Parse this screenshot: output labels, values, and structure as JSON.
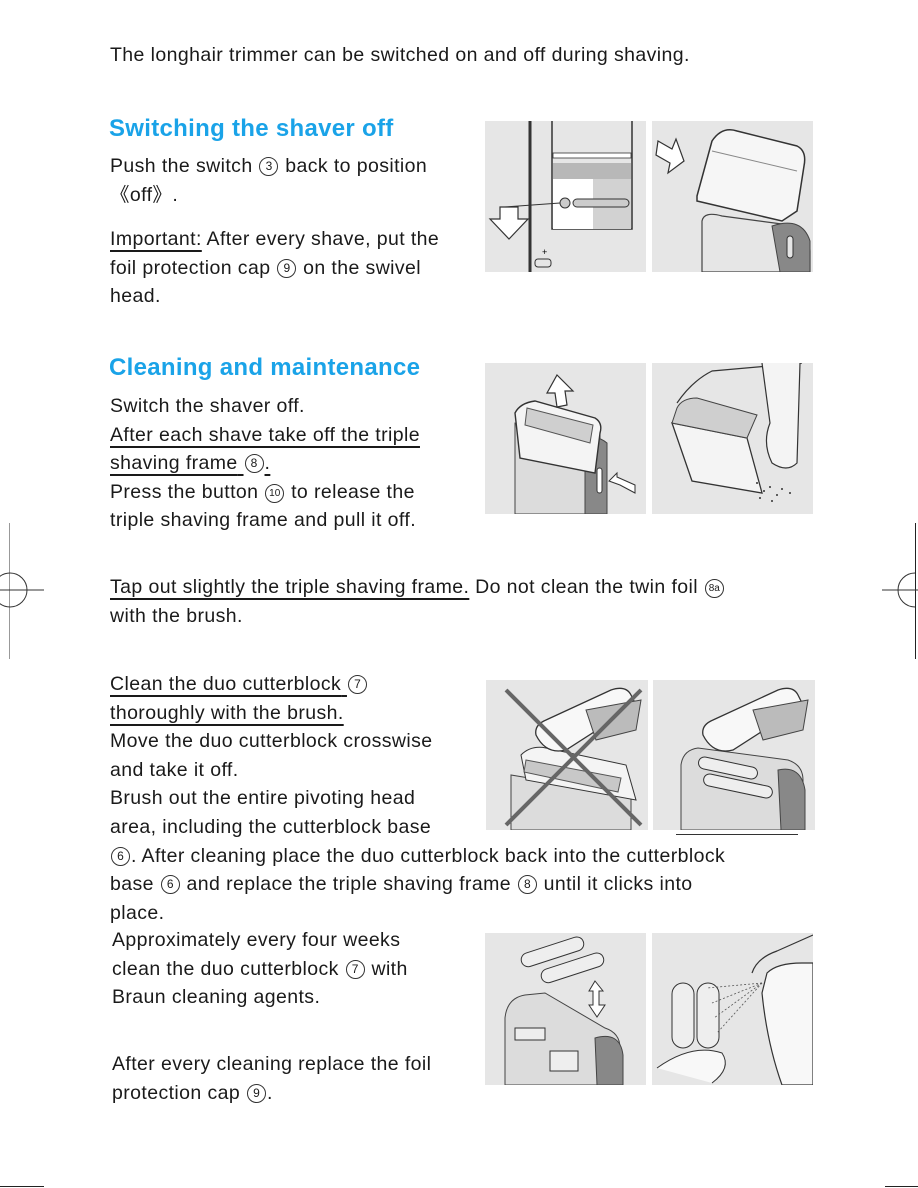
{
  "intro": "The longhair trimmer can be switched on and off during shaving.",
  "section1": {
    "heading": "Switching the shaver off",
    "p1_line1_a": "Push the switch",
    "p1_ref": "3",
    "p1_line1_b": "back to position",
    "p1_line2": "《off》.",
    "important_label": "Important:",
    "important_line1": " After every shave, put the",
    "important_line2_a": "foil protection cap",
    "important_ref": "9",
    "important_line2_b": "on the swivel",
    "important_line3": "head."
  },
  "section2": {
    "heading": "Cleaning and maintenance",
    "line1": "Switch the shaver off.",
    "line2": "After each shave take off the triple",
    "line3_a": "shaving frame",
    "line3_ref": "8",
    "line3_b": ".",
    "line4_a": "Press the button",
    "line4_ref": "10",
    "line4_b": "to release the",
    "line5": "triple shaving frame and pull it off."
  },
  "tap": {
    "underlined": "Tap out slightly the triple shaving frame.",
    "rest": " Do not clean the twin foil",
    "ref": "8a",
    "line2": "with the brush."
  },
  "cutterblock": {
    "line1_a": "Clean the duo cutterblock",
    "line1_ref": "7",
    "line2": "thoroughly with the brush.",
    "line3": "Move the duo cutterblock crosswise",
    "line4": "and take it off.",
    "line5": "Brush out the entire pivoting head",
    "line6": "area, including the cutterblock base",
    "line7_ref": "6",
    "line7": ".  After cleaning place the duo cutterblock back into the cutterblock",
    "line8_a": "base",
    "line8_ref1": "6",
    "line8_b": "and replace the triple shaving frame",
    "line8_ref2": "8",
    "line8_c": "until it clicks into",
    "line9": "place."
  },
  "agents": {
    "line1": "Approximately every four weeks",
    "line2_a": "clean the duo cutterblock",
    "line2_ref": "7",
    "line2_b": "with",
    "line3": "Braun cleaning agents."
  },
  "final": {
    "line1": "After every cleaning replace the foil",
    "line2_a": "protection cap",
    "line2_ref": "9",
    "line2_b": "."
  },
  "colors": {
    "heading": "#1aa3e8",
    "illustration_bg": "#e6e6e6",
    "text": "#1a1a1a"
  },
  "illustrations": [
    "switch-off-diagram",
    "foil-cap-diagram",
    "release-frame-diagram",
    "tap-frame-diagram",
    "wrong-brush-foil-diagram",
    "brush-cutterblock-diagram",
    "remove-cutterblock-diagram",
    "spray-cleaning-diagram"
  ]
}
